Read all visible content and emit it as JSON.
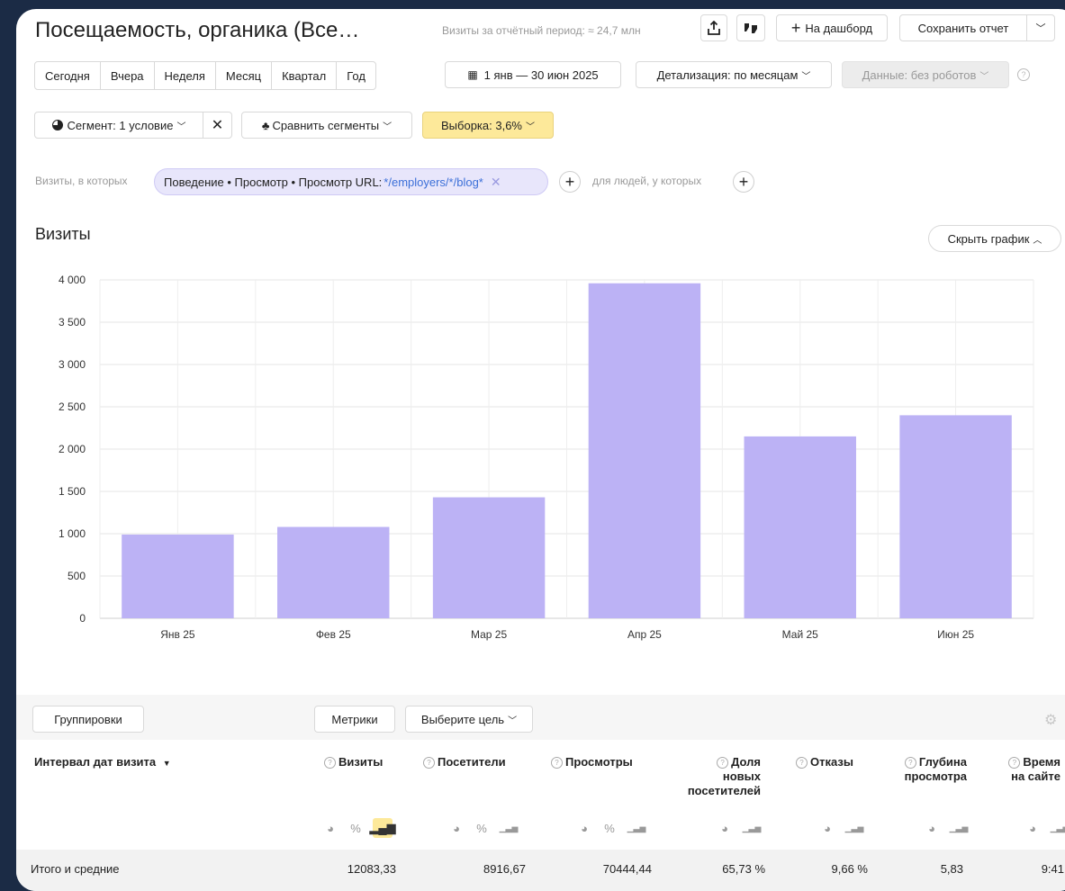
{
  "header": {
    "title": "Посещаемость, органика (Все…",
    "visits_period": "Визиты за отчётный период: ≈ 24,7 млн",
    "dashboard_label": "На дашборд",
    "save_label": "Сохранить отчет"
  },
  "periods": [
    "Сегодня",
    "Вчера",
    "Неделя",
    "Месяц",
    "Квартал",
    "Год"
  ],
  "date_range": "1 янв — 30 июн 2025",
  "detail": "Детализация: по месяцам",
  "robots": "Данные: без роботов",
  "segment": {
    "label": "Сегмент: 1 условие",
    "compare": "Сравнить сегменты",
    "sample": "Выборка: 3,6%"
  },
  "filter": {
    "prefix": "Визиты, в которых",
    "condition_main": "Поведение • Просмотр • Просмотр URL: ",
    "condition_value": "*/employers/*/blog*",
    "people": "для людей, у которых"
  },
  "chart_section": {
    "title": "Визиты",
    "hide": "Скрыть график"
  },
  "chart_data": {
    "type": "bar",
    "categories": [
      "Янв 25",
      "Фев 25",
      "Мар 25",
      "Апр 25",
      "Май 25",
      "Июн 25"
    ],
    "values": [
      990,
      1080,
      1430,
      3960,
      2150,
      2400
    ],
    "ylim": [
      0,
      4000
    ],
    "yticks": [
      0,
      500,
      1000,
      1500,
      2000,
      2500,
      3000,
      3500,
      4000
    ],
    "ytick_labels": [
      "0",
      "500",
      "1 000",
      "1 500",
      "2 000",
      "2 500",
      "3 000",
      "3 500",
      "4 000"
    ],
    "grid": true,
    "color": "#bcb2f5"
  },
  "table": {
    "groupings": "Группировки",
    "metrics": "Метрики",
    "goal": "Выберите цель",
    "dim_header": "Интервал дат визита",
    "columns": {
      "visits": "Визиты",
      "visitors": "Посетители",
      "views": "Просмотры",
      "new_share": [
        "Доля",
        "новых",
        "посетителей"
      ],
      "bounces": "Отказы",
      "depth": [
        "Глубина",
        "просмотра"
      ],
      "time": [
        "Время",
        "на сайте"
      ]
    },
    "totals": {
      "label": "Итого и средние",
      "visits": "12083,33",
      "visitors": "8916,67",
      "views": "70444,44",
      "new_share": "65,73 %",
      "bounces": "9,66 %",
      "depth": "5,83",
      "time": "9:41"
    }
  }
}
